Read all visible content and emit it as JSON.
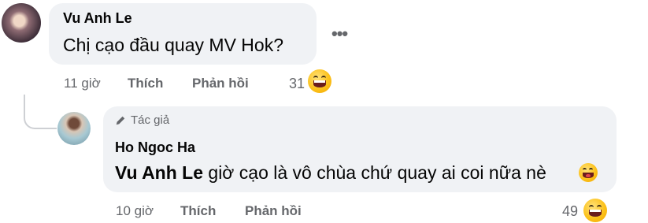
{
  "comments": [
    {
      "author": "Vu Anh Le",
      "text": "Chị cạo đầu quay MV Hok?",
      "time": "11 giờ",
      "like_label": "Thích",
      "reply_label": "Phản hồi",
      "reaction_count": "31",
      "more_icon": "more-options-icon"
    }
  ],
  "reply": {
    "badge": "Tác giả",
    "author": "Ho Ngoc Ha",
    "mention": "Vu Anh Le",
    "text": "giờ cạo là vô chùa chứ quay ai coi nữa nè",
    "time": "10 giờ",
    "like_label": "Thích",
    "reply_label": "Phản hồi",
    "reaction_count": "49"
  },
  "colors": {
    "bubble": "#f0f2f5",
    "meta": "#65676b",
    "text": "#050505"
  }
}
